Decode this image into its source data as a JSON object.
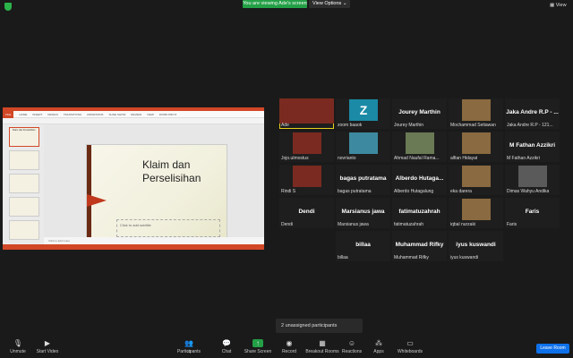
{
  "banner": {
    "viewing": "You are viewing Ade's screen",
    "view_options": "View Options",
    "view": "View"
  },
  "slide": {
    "title": "Klaim dan Perselisihan",
    "subtitle_placeholder": "Click to add subtitle",
    "notes_placeholder": "Click to add notes",
    "ribbon_tabs": [
      "FILE",
      "HOME",
      "INSERT",
      "DESIGN",
      "TRANSITIONS",
      "ANIMATIONS",
      "SLIDE SHOW",
      "REVIEW",
      "VIEW",
      "WORD PRO 8"
    ],
    "thumbs": [
      "Klaim dan Perselisihan",
      "",
      "",
      "",
      "",
      ""
    ]
  },
  "participants": [
    {
      "name": "Ade",
      "label": "",
      "kind": "video"
    },
    {
      "name": "zoom baaok",
      "label": "Z",
      "kind": "avatar"
    },
    {
      "name": "Jourey Marthin",
      "label": "Jourey Marthin",
      "kind": "name"
    },
    {
      "name": "Mochammad Setiawan",
      "label": "",
      "kind": "video"
    },
    {
      "name": "Jaka Andre R.P - 121...",
      "label": "Jaka Andre R.P - ...",
      "kind": "name"
    },
    {
      "name": "Jojo.ulmostus",
      "label": "",
      "kind": "video"
    },
    {
      "name": "novrianto",
      "label": "",
      "kind": "video"
    },
    {
      "name": "Ahmad Naufal Rama...",
      "label": "",
      "kind": "video"
    },
    {
      "name": "alfian Hidayat",
      "label": "",
      "kind": "video"
    },
    {
      "name": "M Fathan Azzikri",
      "label": "M Fathan Azzikri",
      "kind": "name"
    },
    {
      "name": "Rindi S",
      "label": "",
      "kind": "video"
    },
    {
      "name": "bagas putratama",
      "label": "bagas putratama",
      "kind": "name"
    },
    {
      "name": "Alberdo Hutagalung",
      "label": "Alberdo  Hutaga...",
      "kind": "name"
    },
    {
      "name": "eka darera",
      "label": "",
      "kind": "video"
    },
    {
      "name": "Dimas Wahyu Andika",
      "label": "",
      "kind": "video"
    },
    {
      "name": "Dendi",
      "label": "Dendi",
      "kind": "name"
    },
    {
      "name": "Marsianus jawa",
      "label": "Marsianus jawa",
      "kind": "name"
    },
    {
      "name": "fatimatuzahrah",
      "label": "fatimatuzahrah",
      "kind": "name"
    },
    {
      "name": "iqbal nurzaki",
      "label": "",
      "kind": "video"
    },
    {
      "name": "Faris",
      "label": "Faris",
      "kind": "name"
    },
    {
      "name": "billaa",
      "label": "billaa",
      "kind": "name"
    },
    {
      "name": "Muhammad Rifky",
      "label": "Muhammad Rifky",
      "kind": "name"
    },
    {
      "name": "iyus kuswandi",
      "label": "iyus kuswandi",
      "kind": "name"
    }
  ],
  "toast": "2 unassigned participants",
  "toolbar": {
    "unmute": "Unmute",
    "start_video": "Start Video",
    "participants": "Participants",
    "participants_count": "23",
    "chat": "Chat",
    "share_screen": "Share Screen",
    "record": "Record",
    "breakout": "Breakout Rooms",
    "reactions": "Reactions",
    "apps": "Apps",
    "whiteboards": "Whiteboards",
    "leave": "Leave Room"
  }
}
